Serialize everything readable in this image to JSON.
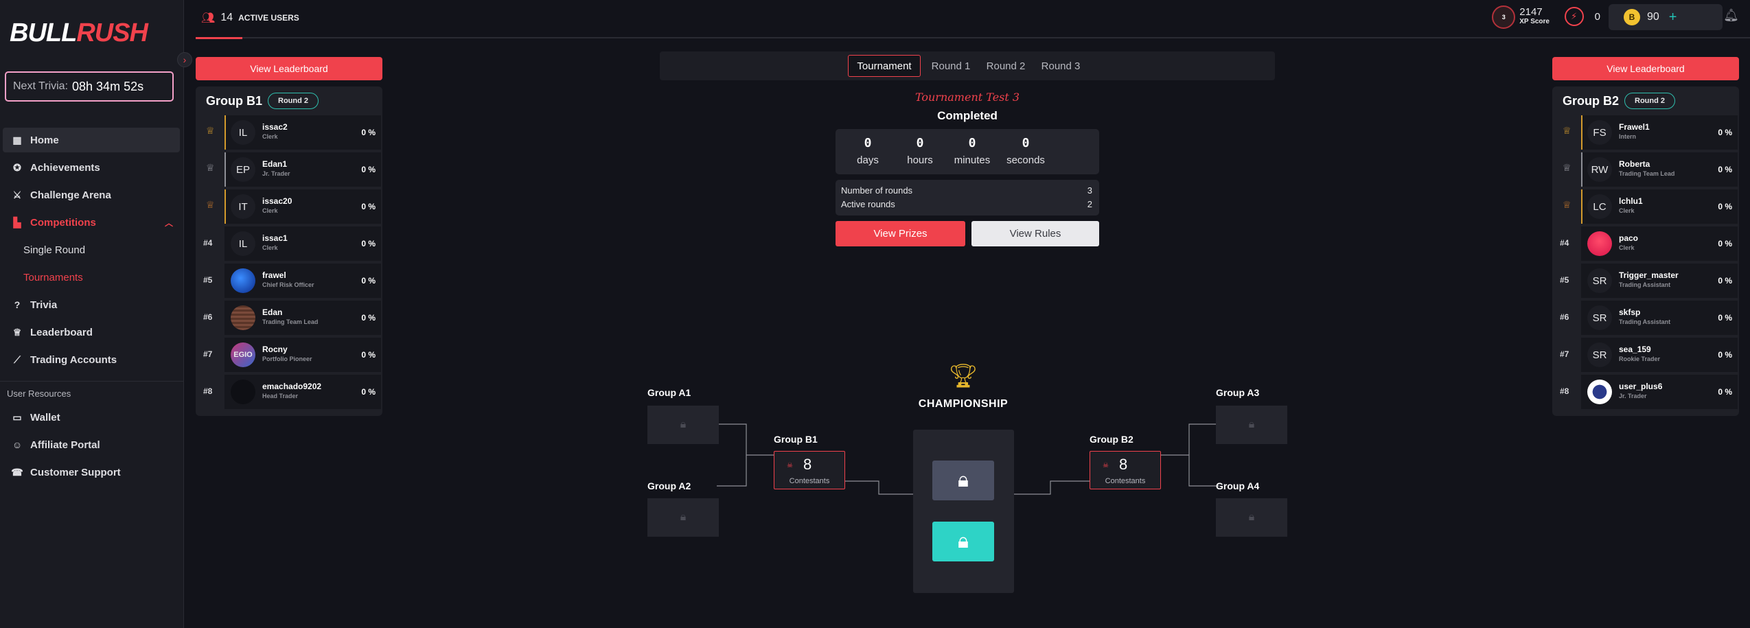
{
  "logo": {
    "part1": "B",
    "part2": "ULL",
    "part3": "RUSH"
  },
  "trivia": {
    "label": "Next Trivia:",
    "value": "08h 34m 52s"
  },
  "sidebar": {
    "items": [
      {
        "label": "Home",
        "icon": "grid-icon"
      },
      {
        "label": "Achievements",
        "icon": "medal-icon"
      },
      {
        "label": "Challenge Arena",
        "icon": "arena-icon"
      },
      {
        "label": "Competitions",
        "icon": "chart-icon"
      },
      {
        "label": "Single Round"
      },
      {
        "label": "Tournaments"
      },
      {
        "label": "Trivia",
        "icon": "question-icon"
      },
      {
        "label": "Leaderboard",
        "icon": "trophy-icon"
      },
      {
        "label": "Trading Accounts",
        "icon": "line-chart-icon"
      }
    ],
    "section_label": "User Resources",
    "resources": [
      {
        "label": "Wallet",
        "icon": "wallet-icon"
      },
      {
        "label": "Affiliate Portal",
        "icon": "user-icon"
      },
      {
        "label": "Customer Support",
        "icon": "support-icon"
      }
    ]
  },
  "topbar": {
    "active_count": "14",
    "active_label": "ACTIVE USERS",
    "xp_level": "3",
    "xp_value": "2147",
    "xp_label": "XP Score",
    "power_value": "0",
    "coins_value": "90",
    "plus": "+"
  },
  "leaderboard_btn": "View Leaderboard",
  "round_badge": "Round 2",
  "group_b1": {
    "title": "Group B1",
    "rows": [
      {
        "rank": "",
        "initials": "IL",
        "name": "issac2",
        "role": "Clerk",
        "pct": "0 %"
      },
      {
        "rank": "",
        "initials": "EP",
        "name": "Edan1",
        "role": "Jr. Trader",
        "pct": "0 %"
      },
      {
        "rank": "",
        "initials": "IT",
        "name": "issac20",
        "role": "Clerk",
        "pct": "0 %"
      },
      {
        "rank": "#4",
        "initials": "IL",
        "name": "issac1",
        "role": "Clerk",
        "pct": "0 %"
      },
      {
        "rank": "#5",
        "initials": "",
        "name": "frawel",
        "role": "Chief Risk Officer",
        "pct": "0 %"
      },
      {
        "rank": "#6",
        "initials": "",
        "name": "Edan",
        "role": "Trading Team Lead",
        "pct": "0 %"
      },
      {
        "rank": "#7",
        "initials": "EGIO",
        "name": "Rocny",
        "role": "Portfolio Pioneer",
        "pct": "0 %"
      },
      {
        "rank": "#8",
        "initials": "",
        "name": "emachado9202",
        "role": "Head Trader",
        "pct": "0 %"
      }
    ]
  },
  "group_b2": {
    "title": "Group B2",
    "rows": [
      {
        "rank": "",
        "initials": "FS",
        "name": "Frawel1",
        "role": "Intern",
        "pct": "0 %"
      },
      {
        "rank": "",
        "initials": "RW",
        "name": "Roberta",
        "role": "Trading Team Lead",
        "pct": "0 %"
      },
      {
        "rank": "",
        "initials": "LC",
        "name": "lchlu1",
        "role": "Clerk",
        "pct": "0 %"
      },
      {
        "rank": "#4",
        "initials": "",
        "name": "paco",
        "role": "Clerk",
        "pct": "0 %"
      },
      {
        "rank": "#5",
        "initials": "SR",
        "name": "Trigger_master",
        "role": "Trading Assistant",
        "pct": "0 %"
      },
      {
        "rank": "#6",
        "initials": "SR",
        "name": "skfsp",
        "role": "Trading Assistant",
        "pct": "0 %"
      },
      {
        "rank": "#7",
        "initials": "SR",
        "name": "sea_159",
        "role": "Rookie Trader",
        "pct": "0 %"
      },
      {
        "rank": "#8",
        "initials": "",
        "name": "user_plus6",
        "role": "Jr. Trader",
        "pct": "0 %"
      }
    ]
  },
  "tabs": [
    "Tournament",
    "Round 1",
    "Round 2",
    "Round 3"
  ],
  "tournament": {
    "name": "Tournament Test 3",
    "status": "Completed",
    "countdown": [
      {
        "value": "0",
        "label": "days"
      },
      {
        "value": "0",
        "label": "hours"
      },
      {
        "value": "0",
        "label": "minutes"
      },
      {
        "value": "0",
        "label": "seconds"
      }
    ],
    "rounds_label": "Number of rounds",
    "rounds_value": "3",
    "active_label": "Active rounds",
    "active_value": "2",
    "prizes_btn": "View Prizes",
    "rules_btn": "View Rules"
  },
  "bracket": {
    "championship": "CHAMPIONSHIP",
    "group_a1": "Group A1",
    "group_a2": "Group A2",
    "group_a3": "Group A3",
    "group_a4": "Group A4",
    "group_b1_label": "Group B1",
    "group_b2_label": "Group B2",
    "b1_count": "8",
    "b2_count": "8",
    "contestants": "Contestants"
  },
  "colors": {
    "accent": "#f0424c",
    "teal": "#2ed3c6",
    "gold": "#e6b72c",
    "background": "#12131a"
  }
}
